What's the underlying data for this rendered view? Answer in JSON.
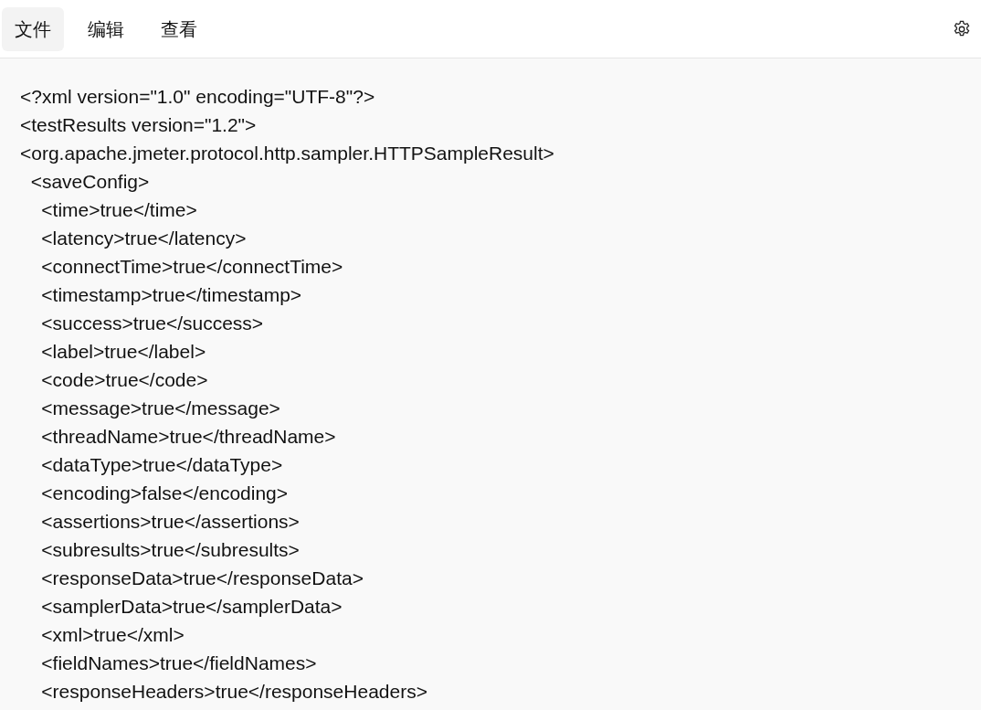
{
  "menu": [
    {
      "label": "文件",
      "selected": true
    },
    {
      "label": "编辑",
      "selected": false
    },
    {
      "label": "查看",
      "selected": false
    }
  ],
  "editor": {
    "lines": [
      "<?xml version=\"1.0\" encoding=\"UTF-8\"?>",
      "<testResults version=\"1.2\">",
      "<org.apache.jmeter.protocol.http.sampler.HTTPSampleResult>",
      "  <saveConfig>",
      "    <time>true</time>",
      "    <latency>true</latency>",
      "    <connectTime>true</connectTime>",
      "    <timestamp>true</timestamp>",
      "    <success>true</success>",
      "    <label>true</label>",
      "    <code>true</code>",
      "    <message>true</message>",
      "    <threadName>true</threadName>",
      "    <dataType>true</dataType>",
      "    <encoding>false</encoding>",
      "    <assertions>true</assertions>",
      "    <subresults>true</subresults>",
      "    <responseData>true</responseData>",
      "    <samplerData>true</samplerData>",
      "    <xml>true</xml>",
      "    <fieldNames>true</fieldNames>",
      "    <responseHeaders>true</responseHeaders>"
    ]
  }
}
